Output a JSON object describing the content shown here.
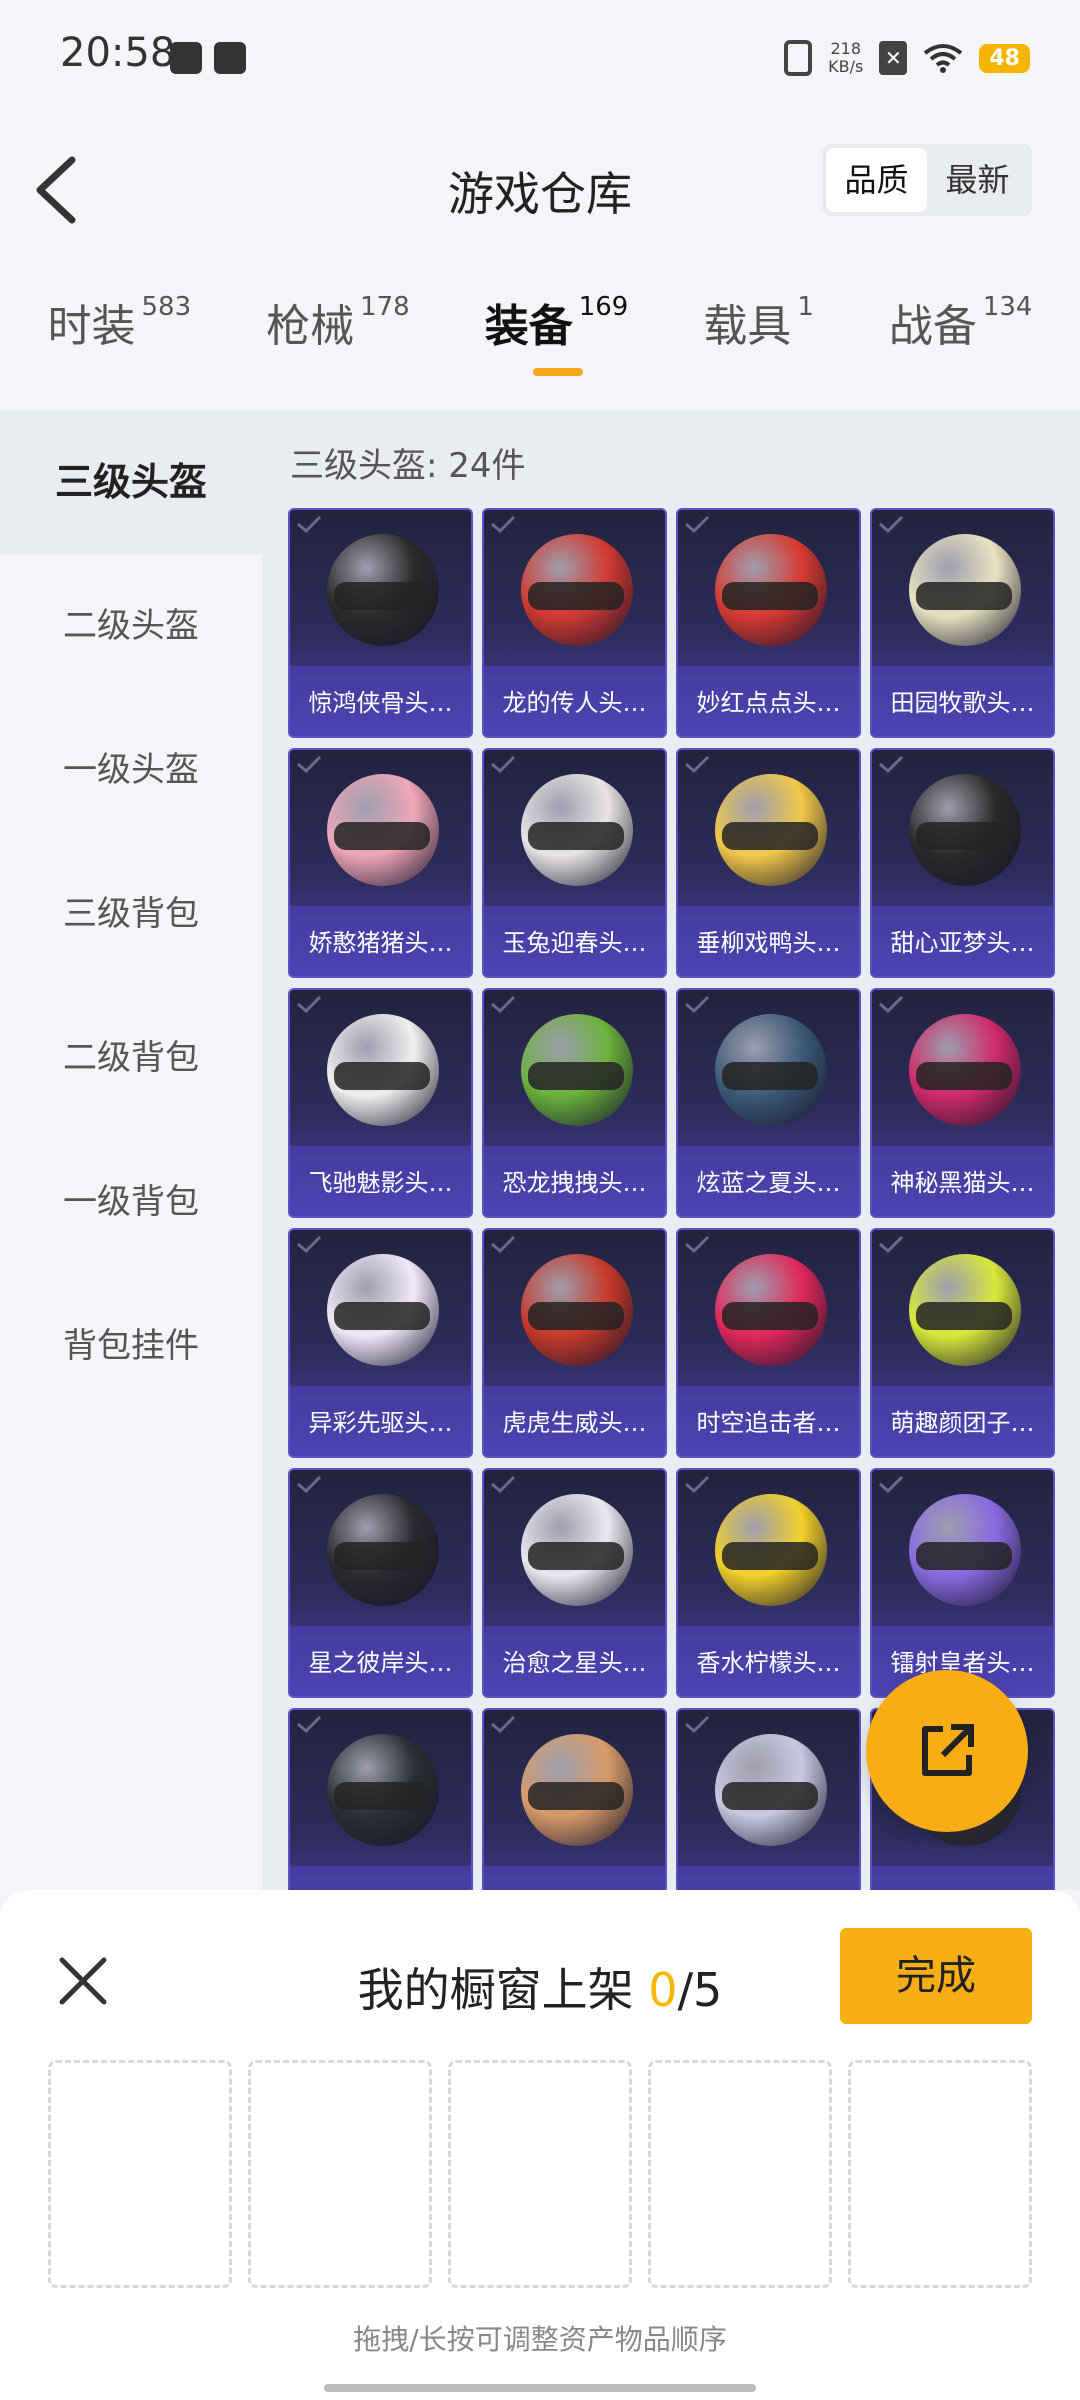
{
  "status_bar": {
    "time": "20:58",
    "net_speed_value": "218",
    "net_speed_unit": "KB/s",
    "battery": "48"
  },
  "header": {
    "title": "游戏仓库",
    "sort": {
      "option1": "品质",
      "option2": "最新"
    }
  },
  "categories": [
    {
      "label": "时装",
      "count": "583"
    },
    {
      "label": "枪械",
      "count": "178"
    },
    {
      "label": "装备",
      "count": "169"
    },
    {
      "label": "载具",
      "count": "1"
    },
    {
      "label": "战备",
      "count": "134"
    }
  ],
  "sidebar": [
    "三级头盔",
    "二级头盔",
    "一级头盔",
    "三级背包",
    "二级背包",
    "一级背包",
    "背包挂件"
  ],
  "section": {
    "title": "三级头盔: 24件"
  },
  "items": [
    {
      "name": "惊鸿侠骨头…",
      "color": "#2b2b2b"
    },
    {
      "name": "龙的传人头…",
      "color": "#d23a32"
    },
    {
      "name": "妙红点点头…",
      "color": "#d83a32"
    },
    {
      "name": "田园牧歌头…",
      "color": "#e8e2c0"
    },
    {
      "name": "娇憨猪猪头…",
      "color": "#f0a6b8"
    },
    {
      "name": "玉兔迎春头…",
      "color": "#e8e4e4"
    },
    {
      "name": "垂柳戏鸭头…",
      "color": "#f2c84a"
    },
    {
      "name": "甜心亚梦头…",
      "color": "#2a2a2a"
    },
    {
      "name": "飞驰魅影头…",
      "color": "#f0f0f0"
    },
    {
      "name": "恐龙拽拽头…",
      "color": "#6bb23c"
    },
    {
      "name": "炫蓝之夏头…",
      "color": "#3c5a78"
    },
    {
      "name": "神秘黑猫头…",
      "color": "#d02a6a"
    },
    {
      "name": "异彩先驱头…",
      "color": "#f0e8f8"
    },
    {
      "name": "虎虎生威头…",
      "color": "#c83a2a"
    },
    {
      "name": "时空追击者…",
      "color": "#e0285a"
    },
    {
      "name": "萌趣颜团子…",
      "color": "#d8e83a"
    },
    {
      "name": "星之彼岸头…",
      "color": "#2a2a30"
    },
    {
      "name": "治愈之星头…",
      "color": "#e8e8f0"
    },
    {
      "name": "香水柠檬头…",
      "color": "#f2d02a"
    },
    {
      "name": "镭射皇者头…",
      "color": "#8a6ae0"
    },
    {
      "name": "",
      "color": "#2a3034"
    },
    {
      "name": "",
      "color": "#d89a6a"
    },
    {
      "name": "",
      "color": "#c8c8e0"
    },
    {
      "name": "",
      "color": "#3a3a3a"
    }
  ],
  "sheet": {
    "title_prefix": "我的橱窗上架 ",
    "count": "0",
    "total": "/5",
    "done_label": "完成",
    "hint": "拖拽/长按可调整资产物品顺序"
  }
}
